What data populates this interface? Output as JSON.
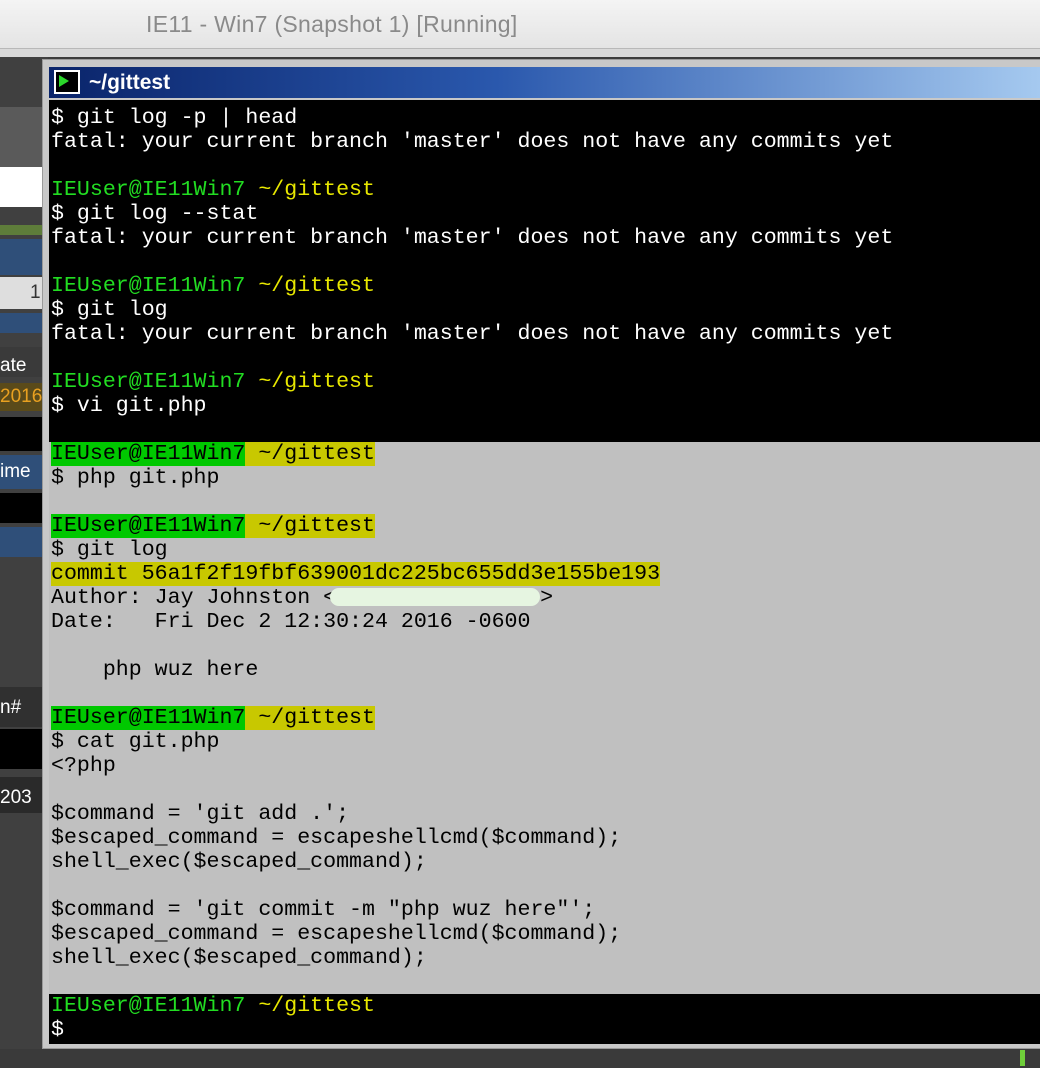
{
  "vm": {
    "title": "IE11 - Win7 (Snapshot 1) [Running]"
  },
  "background_app": {
    "fragments": [
      "1",
      "ate",
      "2016",
      "ime",
      "n#",
      "203"
    ]
  },
  "terminal": {
    "title": "~/gittest",
    "colors": {
      "prompt_green": "#22dd22",
      "path_yellow": "#e8e800",
      "highlight_green": "#00c800",
      "highlight_yellow": "#c8c800"
    },
    "lines": {
      "l1": "$ git log -p | head",
      "l2": "fatal: your current branch 'master' does not have any commits yet",
      "l3_user": "IEUser@IE11Win7",
      "l3_path": " ~/gittest",
      "l4": "$ git log --stat",
      "l5": "fatal: your current branch 'master' does not have any commits yet",
      "l6_user": "IEUser@IE11Win7",
      "l6_path": " ~/gittest",
      "l7": "$ git log",
      "l8": "fatal: your current branch 'master' does not have any commits yet",
      "l9_user": "IEUser@IE11Win7",
      "l9_path": " ~/gittest",
      "l10": "$ vi git.php",
      "l11_user": "IEUser@IE11Win7",
      "l11_path": " ~/gittest",
      "l12": "$ php git.php",
      "l13_user": "IEUser@IE11Win7",
      "l13_path": " ~/gittest",
      "l14": "$ git log",
      "l15": "commit 56a1f2f19fbf639001dc225bc655dd3e155be193",
      "l16_a": "Author: Jay Johnston <",
      "l16_b": ">",
      "l17": "Date:   Fri Dec 2 12:30:24 2016 -0600",
      "l18": "    php wuz here",
      "l19_user": "IEUser@IE11Win7",
      "l19_path": " ~/gittest",
      "l20": "$ cat git.php",
      "l21": "<?php",
      "l22": "$command = 'git add .';",
      "l23": "$escaped_command = escapeshellcmd($command);",
      "l24": "shell_exec($escaped_command);",
      "l25": "$command = 'git commit -m \"php wuz here\"';",
      "l26": "$escaped_command = escapeshellcmd($command);",
      "l27": "shell_exec($escaped_command);",
      "l28_user": "IEUser@IE11Win7",
      "l28_path": " ~/gittest",
      "l29": "$"
    }
  }
}
